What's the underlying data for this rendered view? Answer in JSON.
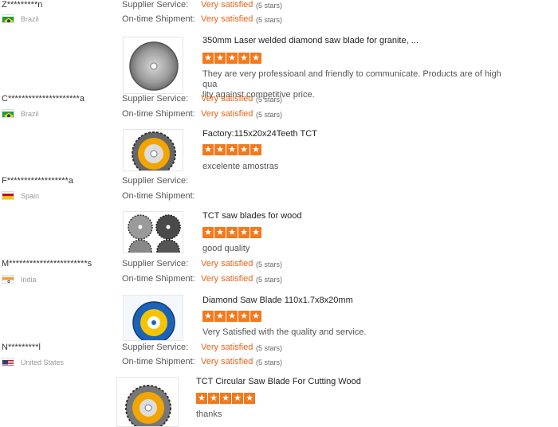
{
  "labels": {
    "supplier_service": "Supplier Service:",
    "on_time_shipment": "On-time Shipment:"
  },
  "reviews": [
    {
      "buyer": "Z*********n",
      "country": "Brazil",
      "flag": "brazil-flag-icon",
      "supplier_service": "Very satisfied",
      "supplier_stars": "(5 stars)",
      "shipment": "Very satisfied",
      "shipment_stars": "(5 stars)"
    },
    {
      "buyer": "C*********************a",
      "country": "Brazil",
      "flag": "brazil-flag-icon",
      "supplier_service": "Very satisfied",
      "supplier_stars": "(5 stars)",
      "shipment": "Very satisfied",
      "shipment_stars": "(5 stars)"
    },
    {
      "buyer": "F******************a",
      "country": "Spain",
      "flag": "spain-flag-icon",
      "supplier_service": "",
      "supplier_stars": "",
      "shipment": "",
      "shipment_stars": ""
    },
    {
      "buyer": "M***********************s",
      "country": "India",
      "flag": "india-flag-icon",
      "supplier_service": "Very satisfied",
      "supplier_stars": "(5 stars)",
      "shipment": "Very satisfied",
      "shipment_stars": "(5 stars)"
    },
    {
      "buyer": "N*********l",
      "country": "United States",
      "flag": "usa-flag-icon",
      "supplier_service": "Very satisfied",
      "supplier_stars": "(5 stars)",
      "shipment": "Very satisfied",
      "shipment_stars": "(5 stars)"
    }
  ],
  "products": [
    {
      "title": "350mm Laser welded diamond saw blade for granite, ...",
      "rating": 5,
      "comment_line1": "They are very professioanl and friendly to communicate. Products are of high qua",
      "comment_line2": "lity against competitive price.",
      "image": "diamond-saw-blade-image"
    },
    {
      "title": "Factory:115x20x24Teeth TCT",
      "rating": 5,
      "comment_line1": "excelente amostras",
      "comment_line2": "",
      "image": "tct-saw-blade-image"
    },
    {
      "title": "TCT saw blades for wood",
      "rating": 5,
      "comment_line1": "good quality",
      "comment_line2": "",
      "image": "tct-saw-blades-set-image"
    },
    {
      "title": "Diamond Saw Blade 110x1.7x8x20mm",
      "rating": 5,
      "comment_line1": "Very Satisfied with the quality and service.",
      "comment_line2": "",
      "image": "diamond-saw-blade-package-image"
    },
    {
      "title": "TCT Circular Saw Blade For Cutting Wood",
      "rating": 5,
      "comment_line1": "thanks",
      "comment_line2": "",
      "image": "tct-circular-saw-blade-image"
    }
  ],
  "colors": {
    "accent": "#e6641a",
    "star": "#f07a1d",
    "label": "#555555",
    "muted": "#999999"
  }
}
